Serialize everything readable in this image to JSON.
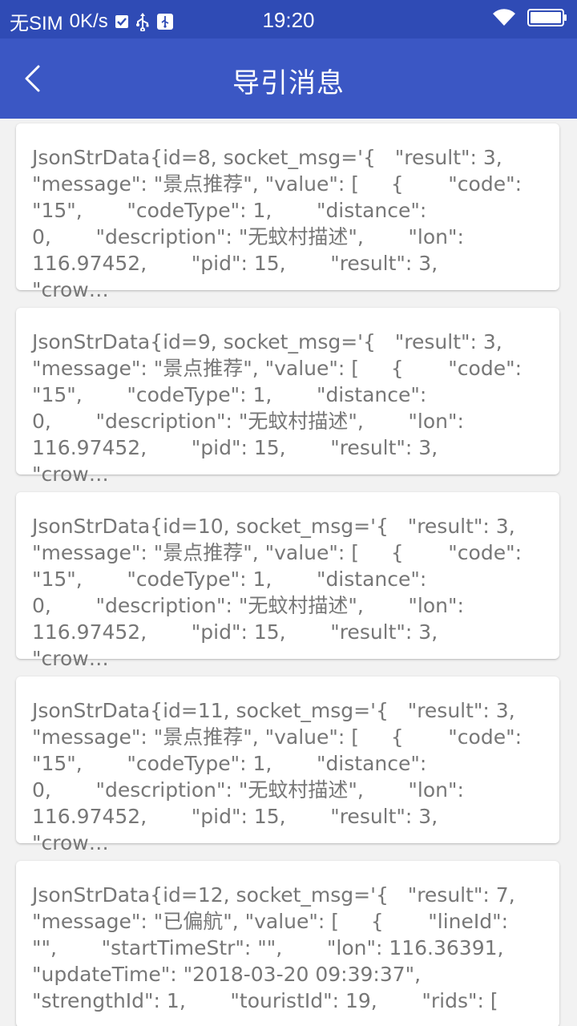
{
  "status_bar": {
    "carrier": "无SIM",
    "speed": "0K/s",
    "time": "19:20"
  },
  "header": {
    "title": "导引消息",
    "back_icon": "chevron-left-icon"
  },
  "colors": {
    "statusbar": "#2f4bb5",
    "appbar": "#3b57c4",
    "card_text": "#777777",
    "background": "#f2f2f2"
  },
  "messages": [
    {
      "text": "JsonStrData{id=8, socket_msg='{   \"result\": 3,\n\"message\": \"景点推荐\", \"value\": [     {       \"code\":\n\"15\",       \"codeType\": 1,       \"distance\":\n0,       \"description\": \"无蚊村描述\",       \"lon\":\n116.97452,       \"pid\": 15,       \"result\": 3,       \"crow…"
    },
    {
      "text": "JsonStrData{id=9, socket_msg='{   \"result\": 3,\n\"message\": \"景点推荐\", \"value\": [     {       \"code\":\n\"15\",       \"codeType\": 1,       \"distance\":\n0,       \"description\": \"无蚊村描述\",       \"lon\":\n116.97452,       \"pid\": 15,       \"result\": 3,       \"crow…"
    },
    {
      "text": "JsonStrData{id=10, socket_msg='{   \"result\": 3,\n\"message\": \"景点推荐\", \"value\": [     {       \"code\":\n\"15\",       \"codeType\": 1,       \"distance\":\n0,       \"description\": \"无蚊村描述\",       \"lon\":\n116.97452,       \"pid\": 15,       \"result\": 3,       \"crow…"
    },
    {
      "text": "JsonStrData{id=11, socket_msg='{   \"result\": 3,\n\"message\": \"景点推荐\", \"value\": [     {       \"code\":\n\"15\",       \"codeType\": 1,       \"distance\":\n0,       \"description\": \"无蚊村描述\",       \"lon\":\n116.97452,       \"pid\": 15,       \"result\": 3,       \"crow…"
    },
    {
      "text": "JsonStrData{id=12, socket_msg='{   \"result\": 7,\n\"message\": \"已偏航\", \"value\": [     {       \"lineId\":\n\"\",       \"startTimeStr\": \"\",       \"lon\": 116.36391,\n\"updateTime\": \"2018-03-20 09:39:37\",\n\"strengthId\": 1,       \"touristId\": 19,       \"rids\": [       …"
    }
  ]
}
